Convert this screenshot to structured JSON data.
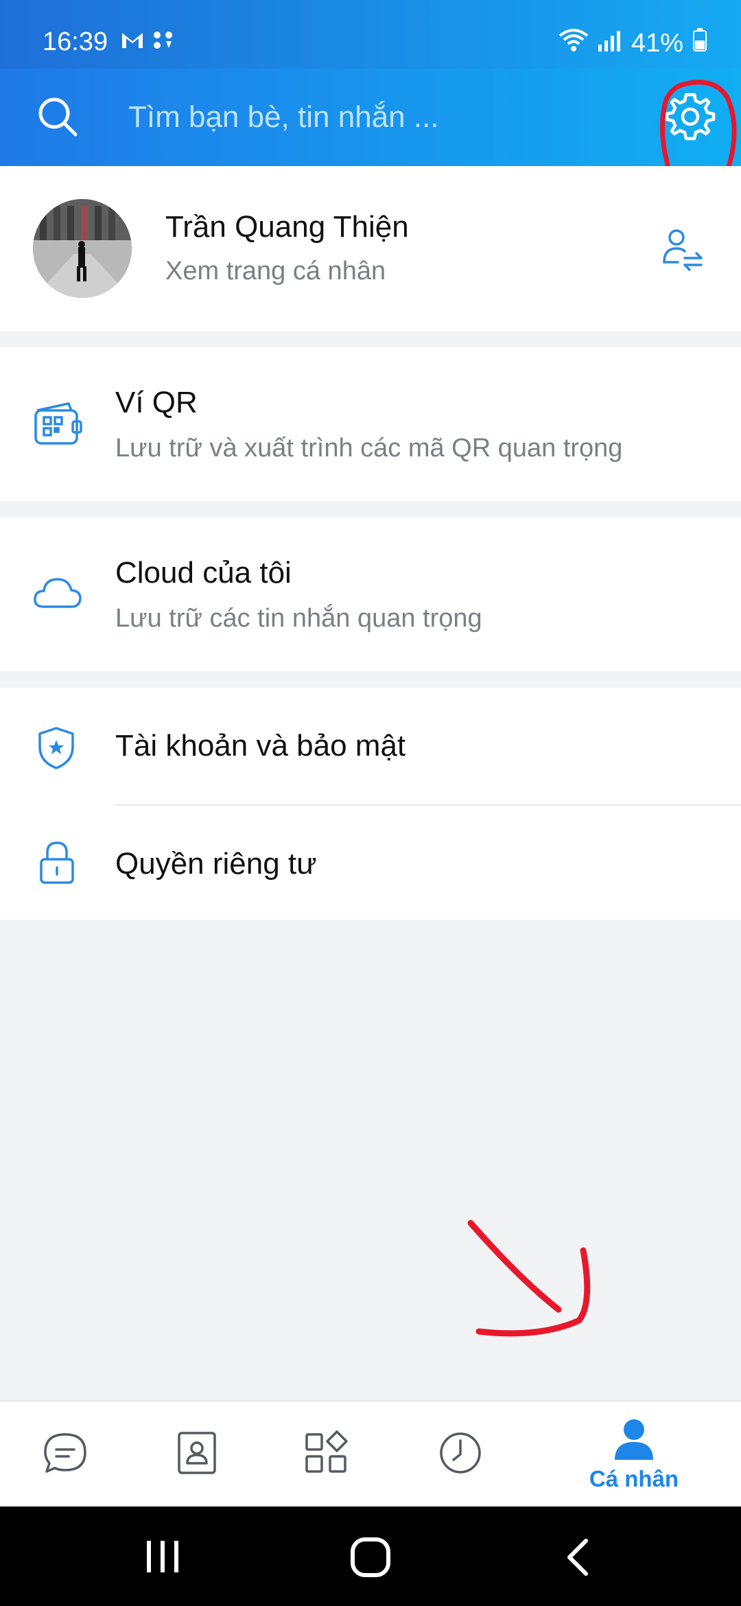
{
  "status_bar": {
    "time": "16:39",
    "battery": "41%"
  },
  "search": {
    "placeholder": "Tìm bạn bè, tin nhắn ..."
  },
  "profile": {
    "name": "Trần Quang Thiện",
    "subtitle": "Xem trang cá nhân"
  },
  "menu": [
    {
      "title": "Ví QR",
      "subtitle": "Lưu trữ và xuất trình các mã QR quan trọng",
      "icon": "qr-wallet-icon"
    },
    {
      "title": "Cloud của tôi",
      "subtitle": "Lưu trữ các tin nhắn quan trọng",
      "icon": "cloud-icon"
    },
    {
      "title": "Tài khoản và bảo mật",
      "icon": "shield-icon"
    },
    {
      "title": "Quyền riêng tư",
      "icon": "lock-icon"
    }
  ],
  "bottom_nav": {
    "items": [
      {
        "icon": "messages-icon"
      },
      {
        "icon": "contacts-icon"
      },
      {
        "icon": "discover-icon"
      },
      {
        "icon": "timeline-icon"
      },
      {
        "icon": "profile-icon",
        "label": "Cá nhân",
        "active": true
      }
    ]
  },
  "colors": {
    "accent": "#1d86e8",
    "header_start": "#1f7ae8",
    "header_end": "#11aef2",
    "annotation": "#e8182c"
  }
}
